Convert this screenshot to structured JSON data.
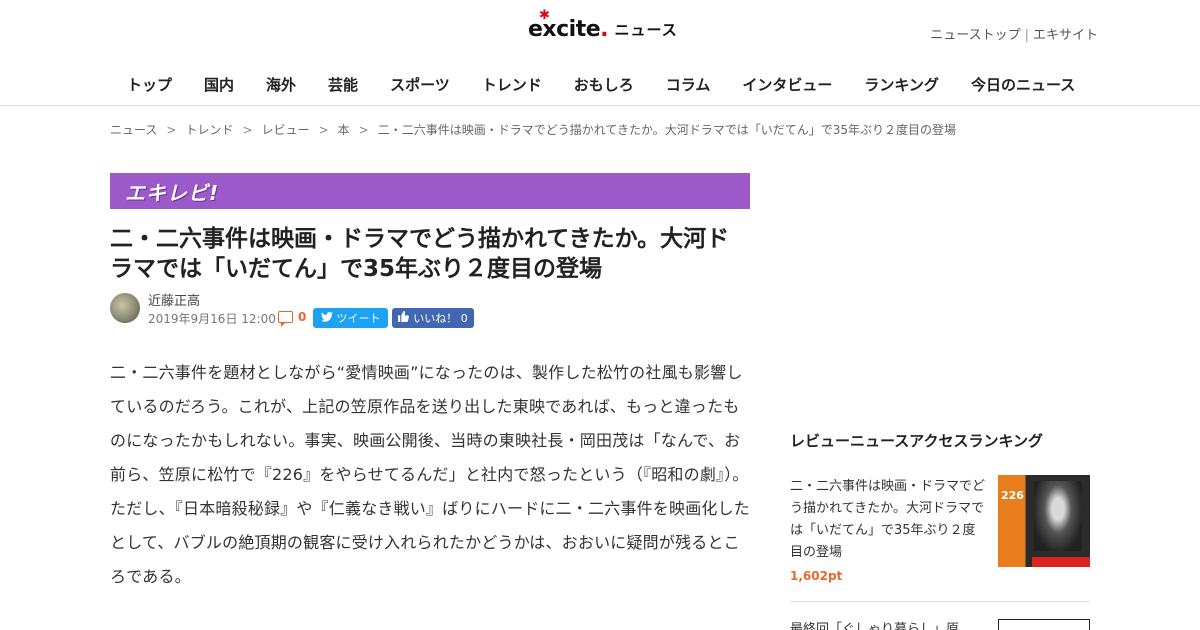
{
  "header": {
    "logo_text": "excite",
    "logo_suffix": "ニュース",
    "top_links": [
      "ニューストップ",
      "エキサイト"
    ],
    "top_links_sep": "|",
    "nav": [
      "トップ",
      "国内",
      "海外",
      "芸能",
      "スポーツ",
      "トレンド",
      "おもしろ",
      "コラム",
      "インタビュー",
      "ランキング",
      "今日のニュース"
    ]
  },
  "breadcrumb": [
    "ニュース",
    "トレンド",
    "レビュー",
    "本",
    "二・二六事件は映画・ドラマでどう描かれてきたか。大河ドラマでは「いだてん」で35年ぶり２度目の登場"
  ],
  "breadcrumb_sep": ">",
  "banner": {
    "label": "エキレビ!",
    "color": "#9b59c9"
  },
  "article": {
    "title": "二・二六事件は映画・ドラマでどう描かれてきたか。大河ドラマでは「いだてん」で35年ぶり２度目の登場",
    "author": "近藤正高",
    "date": "2019年9月16日 12:00",
    "comment_count": "0",
    "tweet_label": "ツイート",
    "like_label": "いいね！ 0",
    "body": "二・二六事件を題材としながら“愛情映画”になったのは、製作した松竹の社風も影響しているのだろう。これが、上記の笠原作品を送り出した東映であれば、もっと違ったものになったかもしれない。事実、映画公開後、当時の東映社長・岡田茂は「なんで、お前ら、笠原に松竹で『226』をやらせてるんだ」と社内で怒ったという（『昭和の劇』）。ただし、『日本暗殺秘録』や『仁義なき戦い』ばりにハードに二・二六事件を映画化したとして、バブルの絶頂期の観客に受け入れられたかどうかは、おおいに疑問が残るところである。"
  },
  "sidebar": {
    "heading": "レビューニュースアクセスランキング",
    "items": [
      {
        "title": "二・二六事件は映画・ドラマでどう描かれてきたか。大河ドラマでは「いだてん」で35年ぶり２度目の登場",
        "points": "1,602pt",
        "thumb_text": "226"
      },
      {
        "title": "最終回「ぐしゃり暮らし」原"
      }
    ]
  },
  "colors": {
    "accent": "#e8682a",
    "twitter": "#1da1f2",
    "facebook": "#4267b2",
    "brand_red": "#e60012"
  }
}
